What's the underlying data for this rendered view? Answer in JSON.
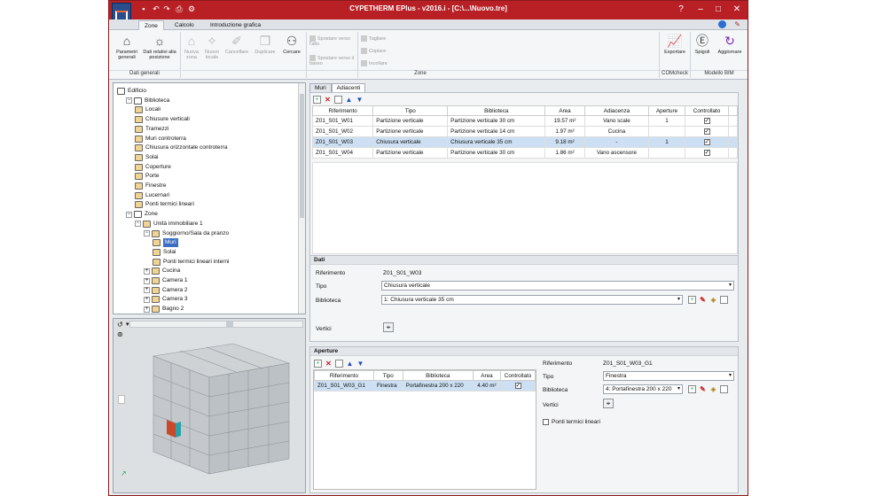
{
  "window": {
    "title": "CYPETHERM EPlus - v2016.i - [C:\\...\\Nuovo.tre]",
    "help": "?",
    "minimize": "–",
    "restore": "□",
    "close": "✕",
    "accent_color": "#b92025"
  },
  "ribbon_tabs": [
    "Zone",
    "Calcolo",
    "Introduzione grafica"
  ],
  "ribbon": {
    "parametri_generali": "Parametri generali",
    "dati_relativi": "Dati relativi alla posizione",
    "nuova_zona": "Nuova zona",
    "nuovo_locale": "Nuovo locale",
    "cancellare": "Cancellare",
    "duplicare": "Duplicare",
    "cercare": "Cercare",
    "spostare_alto": "Spostare verso l'alto",
    "spostare_basso": "Spostare verso il basso",
    "tagliare": "Tagliare",
    "copiare": "Copiare",
    "incollare": "Incollare",
    "esportare": "Esportare",
    "spigoli": "Spigoli",
    "aggiornare": "Aggiornare",
    "group_dati_generali": "Dati generali",
    "group_zone": "Zone",
    "group_comcheck": "COMcheck",
    "group_bim": "Modello BIM"
  },
  "tree": [
    {
      "label": "Edificio",
      "level": 0,
      "icon": "building-icon",
      "pm": ""
    },
    {
      "label": "Biblioteca",
      "level": 1,
      "icon": "book-icon",
      "pm": "−"
    },
    {
      "label": "Locali",
      "level": 2,
      "icon": "room-icon",
      "pm": ""
    },
    {
      "label": "Chiusure verticali",
      "level": 2,
      "icon": "wall-icon",
      "pm": ""
    },
    {
      "label": "Tramezzi",
      "level": 2,
      "icon": "partition-icon",
      "pm": ""
    },
    {
      "label": "Muri controterra",
      "level": 2,
      "icon": "retaining-wall-icon",
      "pm": ""
    },
    {
      "label": "Chiusura orizzontale controterra",
      "level": 2,
      "icon": "ground-slab-icon",
      "pm": ""
    },
    {
      "label": "Solai",
      "level": 2,
      "icon": "slab-icon",
      "pm": ""
    },
    {
      "label": "Coperture",
      "level": 2,
      "icon": "roof-icon",
      "pm": ""
    },
    {
      "label": "Porte",
      "level": 2,
      "icon": "door-icon",
      "pm": ""
    },
    {
      "label": "Finestre",
      "level": 2,
      "icon": "window-icon",
      "pm": ""
    },
    {
      "label": "Lucernari",
      "level": 2,
      "icon": "skylight-icon",
      "pm": ""
    },
    {
      "label": "Ponti termici lineari",
      "level": 2,
      "icon": "thermal-bridge-icon",
      "pm": ""
    },
    {
      "label": "Zone",
      "level": 1,
      "icon": "zone-icon",
      "pm": "−"
    },
    {
      "label": "Unità immobiliare 1",
      "level": 2,
      "icon": "unit-icon",
      "pm": "−"
    },
    {
      "label": "Soggiorno/Sala da pranzo",
      "level": 3,
      "icon": "room-icon",
      "pm": "−"
    },
    {
      "label": "Muri",
      "level": 4,
      "icon": "wall-icon",
      "pm": "",
      "selected": true
    },
    {
      "label": "Solai",
      "level": 4,
      "icon": "slab-icon",
      "pm": ""
    },
    {
      "label": "Ponti termici lineari interni",
      "level": 4,
      "icon": "thermal-bridge-icon",
      "pm": ""
    },
    {
      "label": "Cucina",
      "level": 3,
      "icon": "room-icon",
      "pm": "+"
    },
    {
      "label": "Camera 1",
      "level": 3,
      "icon": "room-icon",
      "pm": "+"
    },
    {
      "label": "Camera 2",
      "level": 3,
      "icon": "room-icon",
      "pm": "+"
    },
    {
      "label": "Camera 3",
      "level": 3,
      "icon": "room-icon",
      "pm": "+"
    },
    {
      "label": "Bagno 2",
      "level": 3,
      "icon": "room-icon",
      "pm": "+"
    }
  ],
  "walls": {
    "tabs": [
      "Muri",
      "Adiacenti"
    ],
    "columns": [
      "Riferimento",
      "Tipo",
      "Biblioteca",
      "Area",
      "Adiacenza",
      "Aperture",
      "Controllato"
    ],
    "rows": [
      [
        "Z01_S01_W01",
        "Partizione verticale",
        "Partizione verticale 30 cm",
        "19.57 m²",
        "Vano scale",
        "1",
        "true"
      ],
      [
        "Z01_S01_W02",
        "Partizione verticale",
        "Partizione verticale 14 cm",
        "1.97 m²",
        "Cucina",
        "",
        "true"
      ],
      [
        "Z01_S01_W03",
        "Chiusura verticale",
        "Chiusura verticale 35 cm",
        "9.18 m²",
        "-",
        "1",
        "true"
      ],
      [
        "Z01_S01_W04",
        "Partizione verticale",
        "Partizione verticale 30 cm",
        "1.86 m²",
        "Vano ascensore",
        "",
        "true"
      ]
    ],
    "selected_row": 2
  },
  "dati": {
    "header": "Dati",
    "riferimento_label": "Riferimento",
    "riferimento_value": "Z01_S01_W03",
    "tipo_label": "Tipo",
    "tipo_value": "Chiusura verticale",
    "biblioteca_label": "Biblioteca",
    "biblioteca_value": "1: Chiusura verticale 35 cm",
    "vertici_label": "Vertici"
  },
  "aperture": {
    "header": "Aperture",
    "columns": [
      "Riferimento",
      "Tipo",
      "Biblioteca",
      "Area",
      "Controllato"
    ],
    "rows": [
      [
        "Z01_S01_W03_G1",
        "Finestra",
        "Portafinestra 200 x 220",
        "4.40 m²",
        "true"
      ]
    ],
    "riferimento_label": "Riferimento",
    "riferimento_value": "Z01_S01_W03_G1",
    "tipo_label": "Tipo",
    "tipo_value": "Finestra",
    "biblioteca_label": "Biblioteca",
    "biblioteca_value": "4: Portafinestra 200 x 220",
    "vertici_label": "Vertici",
    "ponti_label": "Ponti termici lineari"
  }
}
